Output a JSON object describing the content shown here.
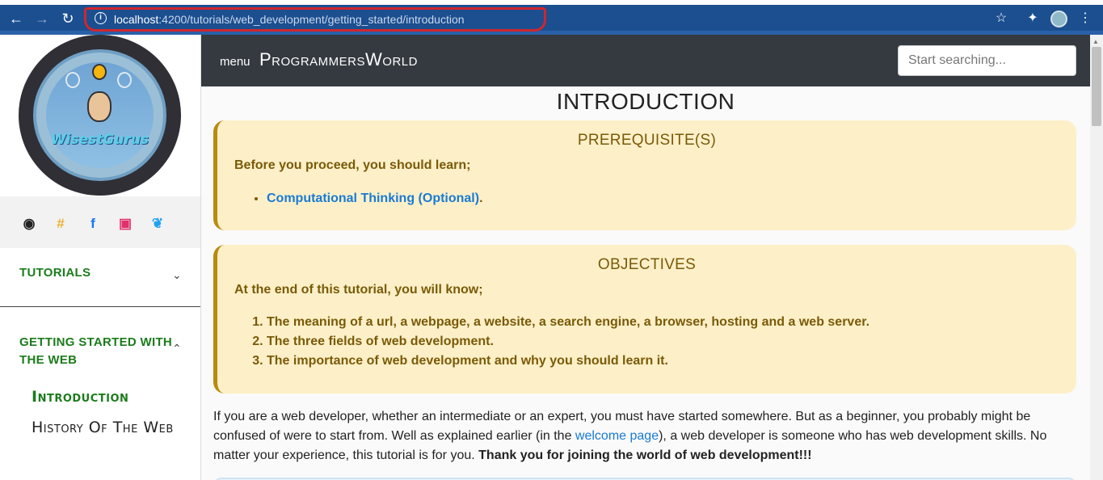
{
  "browser": {
    "url_host": "localhost",
    "url_path": ":4200/tutorials/web_development/getting_started/introduction",
    "back_icon": "arrow-left-icon",
    "forward_icon": "arrow-right-icon",
    "reload_icon": "reload-icon"
  },
  "sidebar": {
    "logo_text": "WisestGurus",
    "social": [
      "github-icon",
      "slack-icon",
      "facebook-icon",
      "instagram-icon",
      "twitter-icon"
    ],
    "sections": [
      {
        "label": "TUTORIALS",
        "expanded": false
      },
      {
        "label": "GETTING STARTED WITH THE WEB",
        "expanded": true
      }
    ],
    "items": [
      {
        "label": "Introduction",
        "active": true
      },
      {
        "label": "History Of The Web",
        "active": false
      }
    ]
  },
  "header": {
    "menu_label": "menu",
    "brand": "ProgrammersWorld",
    "search_placeholder": "Start searching..."
  },
  "main": {
    "title": "INTRODUCTION",
    "prerequisites": {
      "title": "PREREQUISITE(S)",
      "lead": "Before you proceed, you should learn;",
      "items": [
        {
          "link": "Computational Thinking (Optional)",
          "suffix": "."
        }
      ]
    },
    "objectives": {
      "title": "OBJECTIVES",
      "lead": "At the end of this tutorial, you will know;",
      "items": [
        "The meaning of a url, a webpage, a website, a search engine, a browser, hosting and a web server.",
        "The three fields of web development.",
        "The importance of web development and why you should learn it."
      ]
    },
    "paragraph": {
      "part1": "If you are a web developer, whether an intermediate or an expert, you must have started somewhere. But as a beginner, you probably might be confused of were to start from. Well as explained earlier (in the ",
      "link": "welcome page",
      "part2": "), a web developer is someone who has web development skills. No matter your experience, this tutorial is for you. ",
      "bold": "Thank you for joining the world of web development!!!"
    }
  },
  "colors": {
    "accent_green": "#1b7c1b",
    "header_bg": "#343a40",
    "callout_bg": "#fdf0c8",
    "callout_text": "#7a5a08",
    "link": "#1a7ad4",
    "browser_bar": "#1b4f90"
  }
}
